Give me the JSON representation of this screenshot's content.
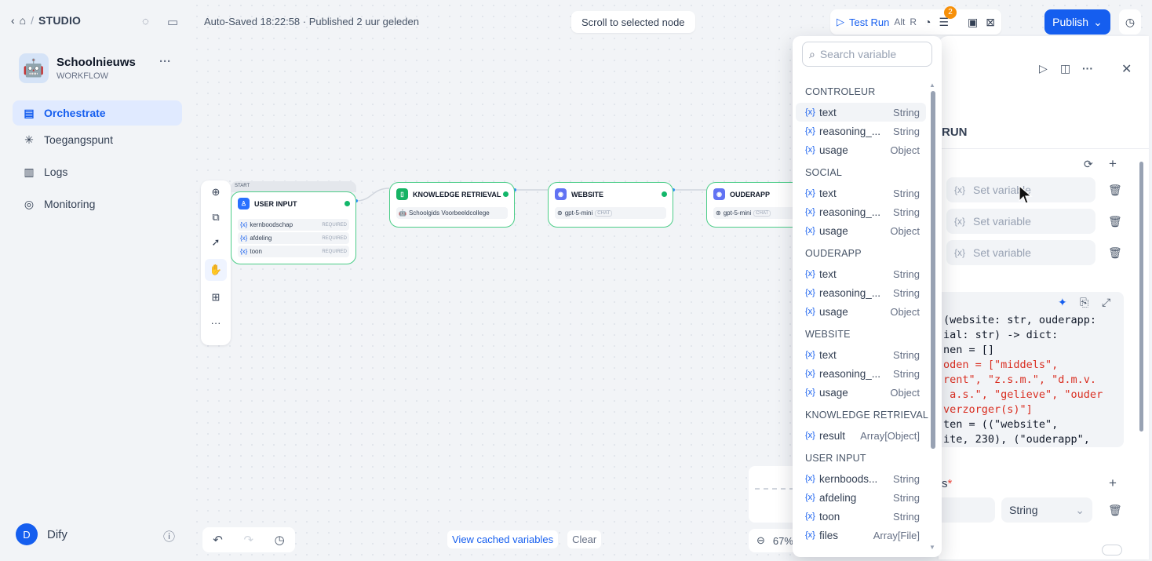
{
  "sidebar": {
    "studio_label": "STUDIO",
    "app_name": "Schoolnieuws",
    "app_type": "WORKFLOW",
    "nav": [
      {
        "label": "Orchestrate",
        "icon": "orchestrate-icon"
      },
      {
        "label": "Toegangspunt",
        "icon": "access-point-icon"
      },
      {
        "label": "Logs",
        "icon": "logs-icon"
      },
      {
        "label": "Monitoring",
        "icon": "monitoring-icon"
      }
    ],
    "user_initial": "D",
    "user_name": "Dify"
  },
  "canvas": {
    "status": "Auto-Saved 18:22:58 · Published 2 uur geleden",
    "scroll_button": "Scroll to selected node",
    "test_run": "Test Run",
    "shortcut_alt": "Alt",
    "shortcut_r": "R",
    "checklist_count": "2",
    "publish": "Publish",
    "view_cached": "View cached variables",
    "clear": "Clear",
    "zoom": "67%"
  },
  "nodes": {
    "start_label": "START",
    "user_input": {
      "title": "USER INPUT",
      "rows": [
        {
          "name": "kernboodschap",
          "tag": "REQUIRED"
        },
        {
          "name": "afdeling",
          "tag": "REQUIRED"
        },
        {
          "name": "toon",
          "tag": "REQUIRED"
        }
      ]
    },
    "knowledge": {
      "title": "KNOWLEDGE RETRIEVAL",
      "dataset": "Schoolgids Voorbeeldcollege"
    },
    "website": {
      "title": "WEBSITE",
      "model": "gpt-5-mini",
      "mode": "CHAT"
    },
    "ouderapp": {
      "title": "OUDERAPP",
      "model": "gpt-5-mini",
      "mode": "CHAT"
    }
  },
  "panel": {
    "run_label": "RUN",
    "set_variable": "Set variable",
    "outputs_label": "s",
    "output_type": "String",
    "code_lines": [
      "(website: str, ouderapp: ",
      "ial: str) -> dict:",
      "nen = []",
      "oden = [\"middels\",",
      "rent\", \"z.s.m.\", \"d.m.v.",
      " a.s.\", \"gelieve\", \"ouder",
      "verzorger(s)\"]",
      "ten = ((\"website\",",
      "ite, 230), (\"ouderapp\","
    ]
  },
  "variable_dropdown": {
    "search_placeholder": "Search variable",
    "groups": [
      {
        "name": "CONTROLEUR",
        "vars": [
          {
            "name": "text",
            "type": "String"
          },
          {
            "name": "reasoning_...",
            "type": "String"
          },
          {
            "name": "usage",
            "type": "Object"
          }
        ]
      },
      {
        "name": "SOCIAL",
        "vars": [
          {
            "name": "text",
            "type": "String"
          },
          {
            "name": "reasoning_...",
            "type": "String"
          },
          {
            "name": "usage",
            "type": "Object"
          }
        ]
      },
      {
        "name": "OUDERAPP",
        "vars": [
          {
            "name": "text",
            "type": "String"
          },
          {
            "name": "reasoning_...",
            "type": "String"
          },
          {
            "name": "usage",
            "type": "Object"
          }
        ]
      },
      {
        "name": "WEBSITE",
        "vars": [
          {
            "name": "text",
            "type": "String"
          },
          {
            "name": "reasoning_...",
            "type": "String"
          },
          {
            "name": "usage",
            "type": "Object"
          }
        ]
      },
      {
        "name": "KNOWLEDGE RETRIEVAL",
        "vars": [
          {
            "name": "result",
            "type": "Array[Object]"
          }
        ]
      },
      {
        "name": "USER INPUT",
        "vars": [
          {
            "name": "kernboods...",
            "type": "String"
          },
          {
            "name": "afdeling",
            "type": "String"
          },
          {
            "name": "toon",
            "type": "String"
          },
          {
            "name": "files",
            "type": "Array[File]"
          }
        ]
      }
    ]
  }
}
